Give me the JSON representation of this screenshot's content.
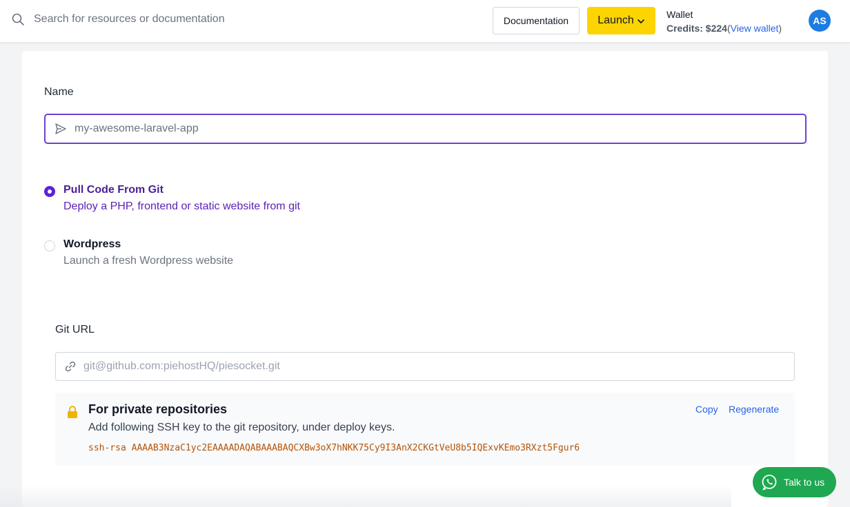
{
  "header": {
    "search_placeholder": "Search for resources or documentation",
    "documentation_label": "Documentation",
    "launch_label": "Launch",
    "wallet": {
      "title": "Wallet",
      "credits_label": "Credits:",
      "credits_value": "$224",
      "open_paren": "(",
      "view_wallet": "View wallet",
      "close_paren": ")"
    },
    "avatar_initials": "AS"
  },
  "form": {
    "name_label": "Name",
    "name_placeholder": "my-awesome-laravel-app",
    "options": [
      {
        "title": "Pull Code From Git",
        "description": "Deploy a PHP, frontend or static website from git",
        "selected": "true"
      },
      {
        "title": "Wordpress",
        "description": "Launch a fresh Wordpress website",
        "selected": "false"
      }
    ],
    "git_url_label": "Git URL",
    "git_url_placeholder": "git@github.com:piehostHQ/piesocket.git",
    "private_repo": {
      "title": "For private repositories",
      "description": "Add following SSH key to the git repository, under deploy keys.",
      "ssh_key": "ssh-rsa AAAAB3NzaC1yc2EAAAADAQABAAABAQCXBw3oX7hNKK75Cy9I3AnX2CKGtVeU8b5IQExvKEmo3RXzt5Fgur6",
      "copy_label": "Copy",
      "regenerate_label": "Regenerate"
    }
  },
  "chat": {
    "label": "Talk to us"
  },
  "colors": {
    "accent_purple": "#5b21d6",
    "launch_yellow": "#fcd400",
    "link_blue": "#2563eb",
    "whatsapp_green": "#1fa851",
    "ssh_key_amber": "#b45309"
  }
}
